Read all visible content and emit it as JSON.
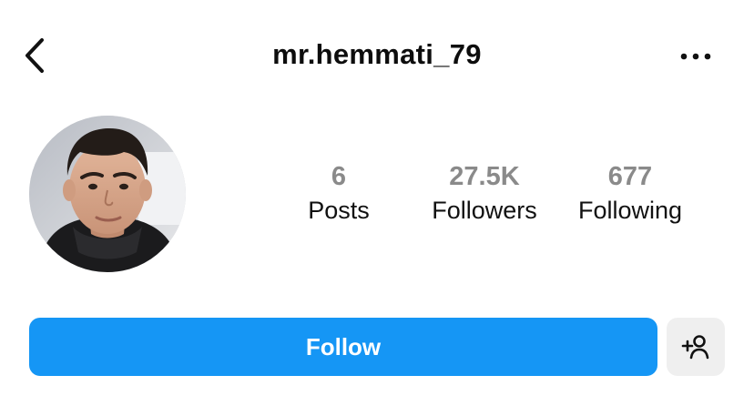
{
  "header": {
    "back_icon": "chevron-left-icon",
    "username": "mr.hemmati_79",
    "more_icon": "ellipsis-horizontal-icon"
  },
  "profile": {
    "avatar_icon": "profile-photo"
  },
  "stats": [
    {
      "value": "6",
      "label": "Posts"
    },
    {
      "value": "27.5K",
      "label": "Followers"
    },
    {
      "value": "677",
      "label": "Following"
    }
  ],
  "actions": {
    "follow_label": "Follow",
    "follow_color": "#1596F5",
    "suggest_icon": "add-person-icon"
  }
}
